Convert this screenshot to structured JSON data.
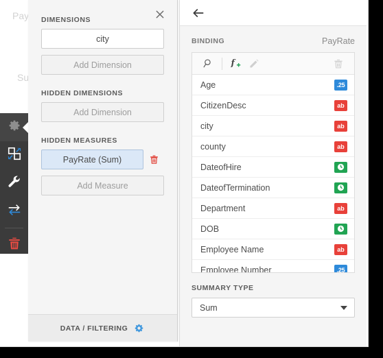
{
  "background": {
    "ghost_text_1": "PayRate",
    "ghost_text_2": "Sum"
  },
  "icon_rail": {
    "items": [
      {
        "name": "settings-gear",
        "icon": "gear-icon",
        "active": true
      },
      {
        "name": "swap-shapes",
        "icon": "swap-squares-icon",
        "active": false
      },
      {
        "name": "tools",
        "icon": "wrench-icon",
        "active": false
      },
      {
        "name": "transfer",
        "icon": "exchange-arrows-icon",
        "active": false
      },
      {
        "name": "delete",
        "icon": "trash-icon",
        "active": false
      }
    ]
  },
  "dimensions_panel": {
    "close_label": "×",
    "sections": {
      "dimensions_title": "DIMENSIONS",
      "dimension_value": "city",
      "add_dimension_label": "Add Dimension",
      "hidden_dimensions_title": "HIDDEN DIMENSIONS",
      "hidden_add_dimension_label": "Add Dimension",
      "hidden_measures_title": "HIDDEN MEASURES",
      "measure_value": "PayRate (Sum)",
      "add_measure_label": "Add Measure"
    },
    "footer": {
      "label": "DATA / FILTERING",
      "gear_color": "#3d96dd"
    }
  },
  "binding_panel": {
    "back_label": "←",
    "title": "BINDING",
    "value": "PayRate",
    "toolbar": {
      "search_label": "search-icon",
      "formula_label": "fx-add-icon",
      "edit_label": "pencil-icon",
      "delete_label": "trash-icon"
    },
    "fields": [
      {
        "label": "Age",
        "type": "num",
        "badge": ".25"
      },
      {
        "label": "CitizenDesc",
        "type": "text",
        "badge": "ab"
      },
      {
        "label": "city",
        "type": "text",
        "badge": "ab"
      },
      {
        "label": "county",
        "type": "text",
        "badge": "ab"
      },
      {
        "label": "DateofHire",
        "type": "date",
        "badge": "clock"
      },
      {
        "label": "DateofTermination",
        "type": "date",
        "badge": "clock"
      },
      {
        "label": "Department",
        "type": "text",
        "badge": "ab"
      },
      {
        "label": "DOB",
        "type": "date",
        "badge": "clock"
      },
      {
        "label": "Employee Name",
        "type": "text",
        "badge": "ab"
      },
      {
        "label": "Employee Number",
        "type": "num",
        "badge": ".25"
      }
    ],
    "summary": {
      "title": "SUMMARY TYPE",
      "value": "Sum"
    }
  },
  "colors": {
    "numeric": "#2e8ada",
    "text": "#e8413a",
    "date": "#21a453",
    "accent": "#3d96dd",
    "danger": "#e03b30",
    "rail": "#3b3b3b"
  }
}
